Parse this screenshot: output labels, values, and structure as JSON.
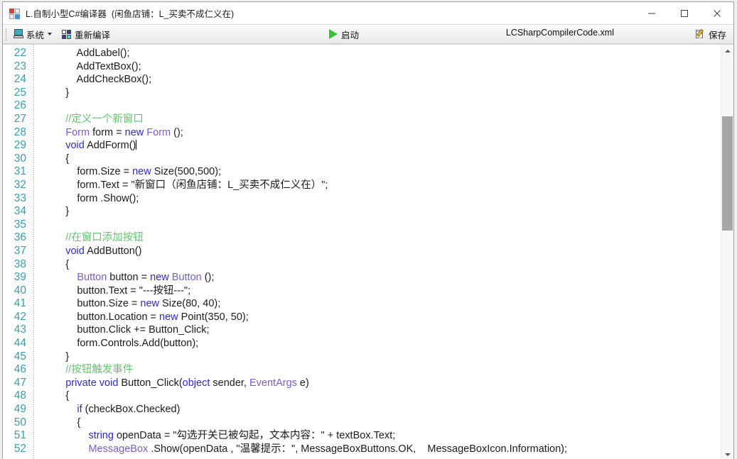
{
  "window": {
    "title_main": "L.自制小型C#编译器",
    "title_sub": "(闲鱼店铺：L_买卖不成仁义在)",
    "icon": "app-window-icon",
    "controls": {
      "minimize": "minimize-icon",
      "maximize": "maximize-icon",
      "close": "close-icon"
    }
  },
  "toolbar": {
    "system_label": "系统",
    "system_icon": "monitor-icon",
    "dropdown_icon": "chevron-down-icon",
    "recompile_label": "重新编译",
    "recompile_icon": "four-pane-icon",
    "start_label": "启动",
    "start_icon": "play-icon",
    "filename": "LCSharpCompilerCode.xml",
    "save_label": "保存",
    "save_icon": "pencil-note-icon"
  },
  "editor": {
    "first_line": 22,
    "line_numbers": [
      22,
      23,
      24,
      25,
      26,
      27,
      28,
      29,
      30,
      31,
      32,
      33,
      34,
      35,
      36,
      37,
      38,
      39,
      40,
      41,
      42,
      43,
      44,
      45,
      46,
      47,
      48,
      49,
      50,
      51,
      52
    ],
    "colors": {
      "line_number": "#36a0ad",
      "keyword": "#2a2ad6",
      "type": "#7a5bd6",
      "comment": "#5fc96a",
      "plain": "#1b1b1b",
      "background": "#ffffff"
    },
    "lines": [
      [
        {
          "t": "            AddLabel();",
          "c": "pln"
        }
      ],
      [
        {
          "t": "            AddTextBox();",
          "c": "pln"
        }
      ],
      [
        {
          "t": "            AddCheckBox();",
          "c": "pln"
        }
      ],
      [
        {
          "t": "        }",
          "c": "pln"
        }
      ],
      [
        {
          "t": "",
          "c": "pln"
        }
      ],
      [
        {
          "t": "        //定义一个新窗口",
          "c": "cmt"
        }
      ],
      [
        {
          "t": "        ",
          "c": "pln"
        },
        {
          "t": "Form",
          "c": "type"
        },
        {
          "t": " form = ",
          "c": "pln"
        },
        {
          "t": "new",
          "c": "kw"
        },
        {
          "t": " ",
          "c": "pln"
        },
        {
          "t": "Form",
          "c": "type"
        },
        {
          "t": " ();",
          "c": "pln"
        }
      ],
      [
        {
          "t": "        ",
          "c": "pln"
        },
        {
          "t": "void",
          "c": "kw"
        },
        {
          "t": " AddForm()",
          "c": "pln"
        },
        {
          "t": "|",
          "c": "caret"
        }
      ],
      [
        {
          "t": "        {",
          "c": "pln"
        }
      ],
      [
        {
          "t": "            form.Size = ",
          "c": "pln"
        },
        {
          "t": "new",
          "c": "kw"
        },
        {
          "t": " Size(500,500);",
          "c": "pln"
        }
      ],
      [
        {
          "t": "            form.Text = \"新窗口（闲鱼店铺：L_买卖不成仁义在）\";",
          "c": "pln"
        }
      ],
      [
        {
          "t": "            form .Show();",
          "c": "pln"
        }
      ],
      [
        {
          "t": "        }",
          "c": "pln"
        }
      ],
      [
        {
          "t": "",
          "c": "pln"
        }
      ],
      [
        {
          "t": "        //在窗口添加按钮",
          "c": "cmt"
        }
      ],
      [
        {
          "t": "        ",
          "c": "pln"
        },
        {
          "t": "void",
          "c": "kw"
        },
        {
          "t": " AddButton()",
          "c": "pln"
        }
      ],
      [
        {
          "t": "        {",
          "c": "pln"
        }
      ],
      [
        {
          "t": "            ",
          "c": "pln"
        },
        {
          "t": "Button",
          "c": "type"
        },
        {
          "t": " button = ",
          "c": "pln"
        },
        {
          "t": "new",
          "c": "kw"
        },
        {
          "t": " ",
          "c": "pln"
        },
        {
          "t": "Button",
          "c": "type"
        },
        {
          "t": " ();",
          "c": "pln"
        }
      ],
      [
        {
          "t": "            button.Text = \"---按钮---\";",
          "c": "pln"
        }
      ],
      [
        {
          "t": "            button.Size = ",
          "c": "pln"
        },
        {
          "t": "new",
          "c": "kw"
        },
        {
          "t": " Size(80, 40);",
          "c": "pln"
        }
      ],
      [
        {
          "t": "            button.Location = ",
          "c": "pln"
        },
        {
          "t": "new",
          "c": "kw"
        },
        {
          "t": " Point(350, 50);",
          "c": "pln"
        }
      ],
      [
        {
          "t": "            button.Click += Button_Click;",
          "c": "pln"
        }
      ],
      [
        {
          "t": "            form.Controls.Add(button);",
          "c": "pln"
        }
      ],
      [
        {
          "t": "        }",
          "c": "pln"
        }
      ],
      [
        {
          "t": "        //按钮触发事件",
          "c": "cmt"
        }
      ],
      [
        {
          "t": "        ",
          "c": "pln"
        },
        {
          "t": "private",
          "c": "kw"
        },
        {
          "t": " ",
          "c": "pln"
        },
        {
          "t": "void",
          "c": "kw"
        },
        {
          "t": " Button_Click(",
          "c": "pln"
        },
        {
          "t": "object",
          "c": "kw"
        },
        {
          "t": " sender, ",
          "c": "pln"
        },
        {
          "t": "EventArgs",
          "c": "type"
        },
        {
          "t": " e)",
          "c": "pln"
        }
      ],
      [
        {
          "t": "        {",
          "c": "pln"
        }
      ],
      [
        {
          "t": "            ",
          "c": "pln"
        },
        {
          "t": "if",
          "c": "kw"
        },
        {
          "t": " (checkBox.Checked)",
          "c": "pln"
        }
      ],
      [
        {
          "t": "            {",
          "c": "pln"
        }
      ],
      [
        {
          "t": "                ",
          "c": "pln"
        },
        {
          "t": "string",
          "c": "kw"
        },
        {
          "t": " openData = \"勾选开关已被勾起，文本内容：\" + textBox.Text;",
          "c": "pln"
        }
      ],
      [
        {
          "t": "                ",
          "c": "pln"
        },
        {
          "t": "MessageBox",
          "c": "type"
        },
        {
          "t": " .Show(openData , \"温馨提示：\", MessageBoxButtons.OK,    MessageBoxIcon.Information);",
          "c": "pln"
        }
      ]
    ]
  },
  "scrollbar": {
    "up_arrow": "scroll-up-icon",
    "down_arrow": "scroll-down-icon",
    "thumb": "scroll-thumb"
  }
}
